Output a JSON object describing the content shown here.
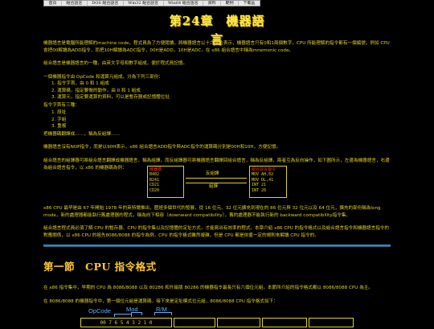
{
  "menu": [
    "首頁",
    "組合語言",
    "DOS 組合語言",
    "Win32 組合語言",
    "Win64 組合語言",
    "資料",
    "範例",
    "下載區"
  ],
  "title": "第24章　機器語言",
  "p1": "機器語言是電腦所能理解的machine code，程式員為了方便閱讀，將機器語言以十六進位表示，機器語言只有0和1兩個數字。CPU 所能理解的指令都有一個編號，例如 CPU 會把00解讀為ADD指令，而把10H解讀為ADC指令，00H是ADD，10H是ADC，在 x86 組合語言中稱為mnemonic code。",
  "p2": "組合語言是機器語言的一種，由英文字母和數字組成，便於程式員記憶。",
  "p3": "一個機器指令由 OpCode 和運算元組成，分為下列三部份：",
  "list1": [
    "1. 指令字首，由 0 和 1 組成",
    "2. 運算碼，指定要做的動作，由 0 和 1 組成",
    "3. 運算元，指定要運算的資料，可以是暫存器或記憶體位址"
  ],
  "p4": "指令字首有三種：",
  "list2": [
    "1. 段址",
    "2. 字組",
    "3. 重複"
  ],
  "p5": "把機器碼翻譯成……，稱為反組譯……",
  "p6": "機器語言沒有NOP指令，而是以90H表示，x86 組合語言ADD指令與ADC指令的運算碼分別是00H和10H，方便記憶。",
  "p7": "組合語言的組譯器可將組合語言翻譯成機器語言，稱為組譯，而反組譯器可將機器語言翻譯回組合語言，稱為反組譯，兩者互為反向操作，如下圖所示，左邊為機器語言，右邊為組合語言指令，以 x86 的機器碼為例：",
  "diagram": {
    "left_header": "機器碼",
    "left_lines": [
      "B402",
      "B241",
      "CD21",
      "CD20"
    ],
    "right_header": "組合語言指令",
    "right_lines": [
      "MOV AH,02",
      "MOV DL,41",
      "INT 21",
      "INT 20"
    ],
    "top_arrow": "反組譯",
    "bottom_arrow": "組譯"
  },
  "p8": "x86 CPU 最早是由 67 年開始 1978 年的英特爾推出，歷經多個世代的發展，從 16 位元、32 位元擴充到現在的 86 位元與 32 位元以及 64 位元，擴充的部份稱為long mode，新的處理器都能執行舊處理器的程式，稱為向下相容（downward compatibility），舊的處理器不能執行新的 backward compatibility指令集。",
  "p9": "組合語言程式員必須了解 CPU 的暫存器、CPU 的指令集以及記憶體的定址方式，才能寫出有效率的程式，本章介紹 x86 CPU 的指令格式以及組合語言指令和機器語言指令的對應關係，以 x86 CPU 的祖先8086/8088 的指令為例，CPU 的指令格式雖然複雜，但是 CPU 都是依循一定的規則來解讀 CPU 指令的。",
  "h2": "第一節　CPU 指令格式",
  "p10": "在 x86 指令集中，早期的 CPU 為 8086/8088 以及 80286 和升級版 80286 的機器指令最長只有六個位元組，本節所介紹的指令格式都以 8086/8088 CPU 為主。",
  "p11": "在 8086/8088 的機器指令中，第一個位元組是運算碼，接下來是定址模式位元組，8086/8088 CPU 指令格式如下：",
  "fig": {
    "label_opcode": "OpCode",
    "label_mod": "Mod",
    "label_rm": "R/M",
    "bits": "00 7 6 5 4 3 2 1 0"
  }
}
